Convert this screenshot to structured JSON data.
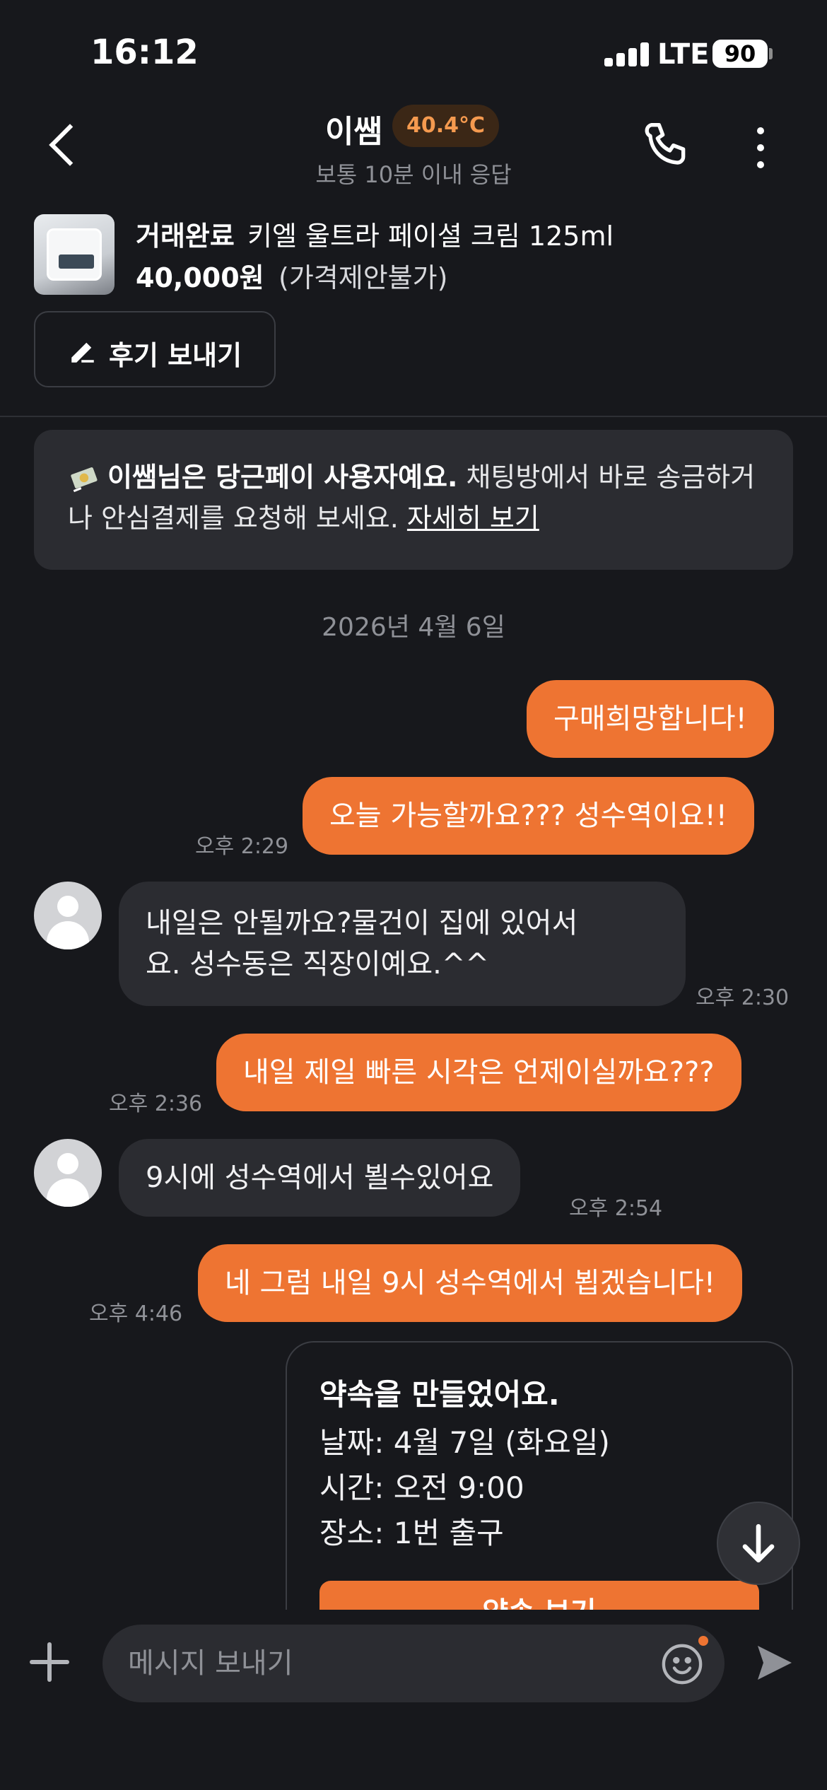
{
  "status_bar": {
    "time": "16:12",
    "network": "LTE",
    "battery": "90"
  },
  "header": {
    "name": "이쌤",
    "temperature": "40.4°C",
    "response_time": "보통 10분 이내 응답",
    "back_icon": "chevron-left-icon",
    "call_icon": "phone-icon",
    "more_icon": "more-vertical-icon"
  },
  "product": {
    "status": "거래완료",
    "title": "키엘 울트라 페이셜 크림 125ml",
    "price": "40,000원",
    "price_note": "(가격제안불가)",
    "review_button": "후기 보내기"
  },
  "notice": {
    "bold_text": "이쌤님은 당근페이 사용자예요.",
    "text": " 채팅방에서 바로 송금하거나 안심결제를 요청해 보세요. ",
    "link": "자세히 보기"
  },
  "date_divider": "2026년 4월 6일",
  "messages": [
    {
      "from": "me",
      "text": "구매희망합니다!",
      "time": ""
    },
    {
      "from": "me",
      "text": "오늘 가능할까요??? 성수역이요!!",
      "time": "오후 2:29"
    },
    {
      "from": "peer",
      "line1": "내일은 안될까요?물건이 집에 있어서",
      "line2": "요. 성수동은 직장이예요.^^",
      "time": "오후 2:30"
    },
    {
      "from": "me",
      "text": "내일 제일 빠른 시각은 언제이실까요???",
      "time": "오후 2:36"
    },
    {
      "from": "peer",
      "text": "9시에 성수역에서 뵐수있어요",
      "time": "오후 2:54"
    },
    {
      "from": "me",
      "text": "네 그럼 내일 9시 성수역에서 뵙겠습니다!",
      "time": "오후 4:46"
    }
  ],
  "appointment": {
    "title": "약속을 만들었어요.",
    "date": "날짜: 4월 7일 (화요일)",
    "time": "시간: 오전 9:00",
    "place": "장소: 1번 출구",
    "button": "약속 보기"
  },
  "input": {
    "placeholder": "메시지 보내기"
  },
  "colors": {
    "accent": "#ee7432",
    "background": "#17181c",
    "bubble_peer": "#2b2c31",
    "temperature": "#f59a4f"
  }
}
